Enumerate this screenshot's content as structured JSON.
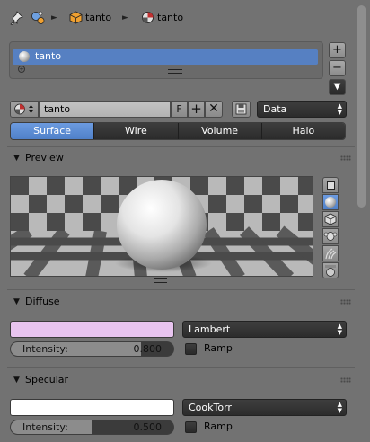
{
  "breadcrumb": {
    "object": "tanto",
    "material": "tanto"
  },
  "slots": {
    "items": [
      {
        "label": "tanto"
      }
    ]
  },
  "id_row": {
    "name": "tanto",
    "fake_user": "F",
    "link": "Data"
  },
  "tabs": [
    {
      "label": "Surface",
      "active": true
    },
    {
      "label": "Wire"
    },
    {
      "label": "Volume"
    },
    {
      "label": "Halo"
    }
  ],
  "preview": {
    "title": "Preview"
  },
  "diffuse": {
    "title": "Diffuse",
    "color": "#e8c4ef",
    "shader": "Lambert",
    "intensity_label": "Intensity:",
    "intensity_value": "0.800",
    "intensity": 0.8,
    "ramp_label": "Ramp"
  },
  "specular": {
    "title": "Specular",
    "color": "#ffffff",
    "shader": "CookTorr",
    "intensity_label": "Intensity:",
    "intensity_value": "0.500",
    "intensity": 0.5,
    "ramp_label": "Ramp"
  },
  "colors": {
    "active": "#5680c2",
    "panel_bg": "#727272",
    "dark_widget": "#363636"
  }
}
